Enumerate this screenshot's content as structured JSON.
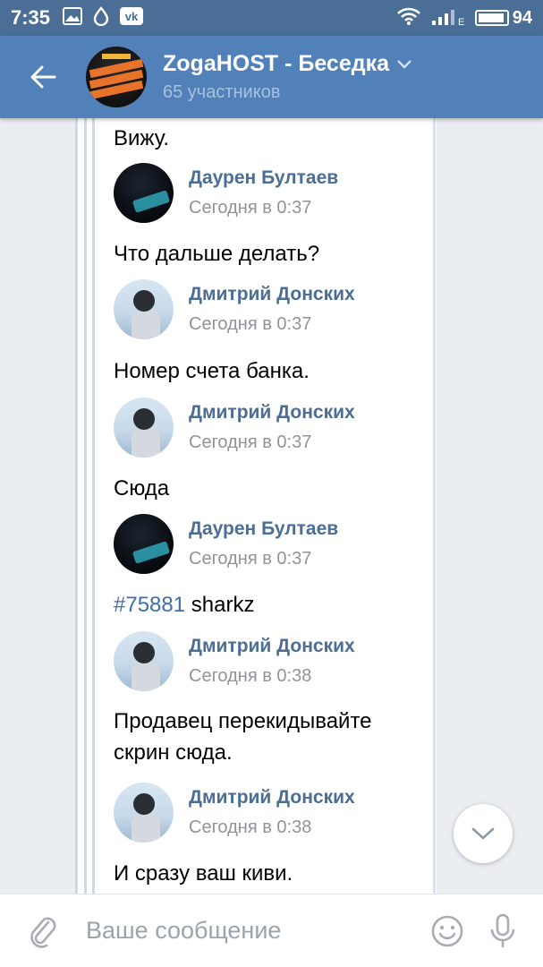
{
  "status_bar": {
    "time": "7:35",
    "network": "E",
    "battery_percent": "94",
    "battery_level": 0.94,
    "icons": [
      "image-icon",
      "drop-icon",
      "vk-icon",
      "wifi-icon",
      "signal-icon",
      "battery-icon"
    ]
  },
  "header": {
    "title": "ZogaHOST - Беседка",
    "subtitle": "65 участников",
    "background": "#5181b8"
  },
  "messages": [
    {
      "type": "text",
      "text": "Вижу."
    },
    {
      "type": "author",
      "name": "Даурен Бултаев",
      "time": "Сегодня в 0:37",
      "avatar": "dark"
    },
    {
      "type": "text",
      "text": "Что дальше делать?"
    },
    {
      "type": "author",
      "name": "Дмитрий Донских",
      "time": "Сегодня в 0:37",
      "avatar": "light"
    },
    {
      "type": "text",
      "text": "Номер счета банка."
    },
    {
      "type": "author",
      "name": "Дмитрий Донских",
      "time": "Сегодня в 0:37",
      "avatar": "light"
    },
    {
      "type": "text",
      "text": "Сюда"
    },
    {
      "type": "author",
      "name": "Даурен Бултаев",
      "time": "Сегодня в 0:37",
      "avatar": "dark"
    },
    {
      "type": "text",
      "hashtag": "#75881",
      "text": "sharkz"
    },
    {
      "type": "author",
      "name": "Дмитрий Донских",
      "time": "Сегодня в 0:38",
      "avatar": "light"
    },
    {
      "type": "text",
      "text": "Продавец перекидывайте",
      "text2": "скрин сюда."
    },
    {
      "type": "author",
      "name": "Дмитрий Донских",
      "time": "Сегодня в 0:38",
      "avatar": "light"
    },
    {
      "type": "text",
      "text": "И сразу ваш киви."
    }
  ],
  "input": {
    "placeholder": "Ваше сообщение"
  },
  "colors": {
    "accent": "#5181b8",
    "author_name": "#4a6e95",
    "hashtag": "#3d6fa8",
    "timestamp": "#909399"
  }
}
